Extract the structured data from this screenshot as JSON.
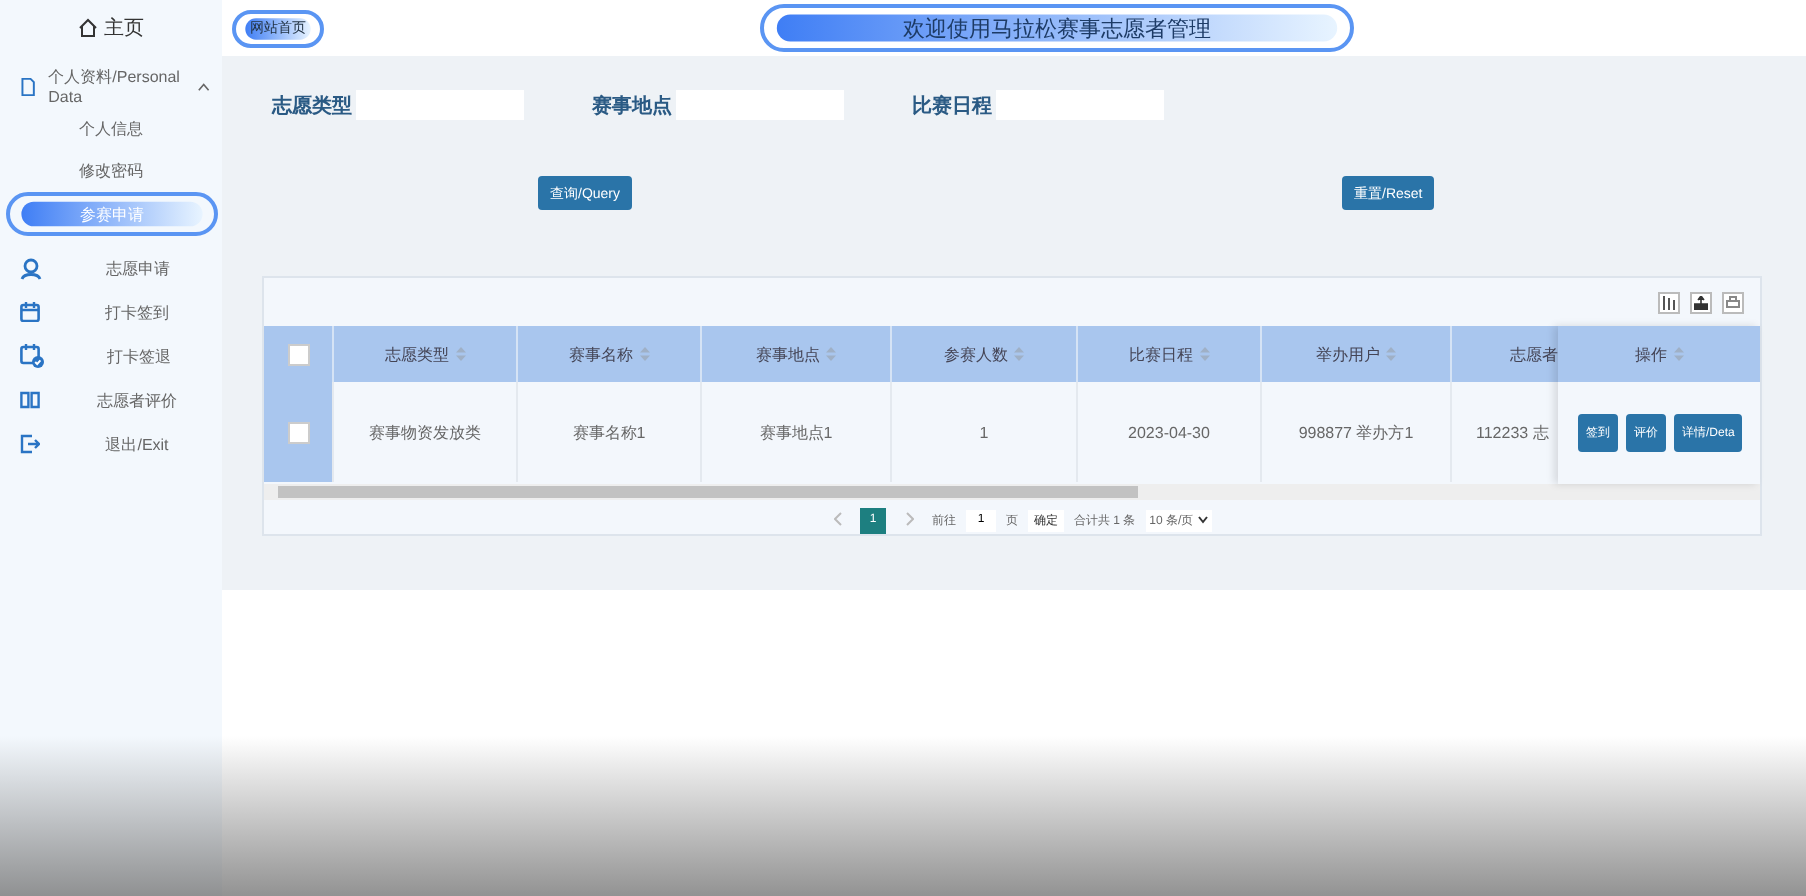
{
  "sidebar": {
    "home": "主页",
    "items": [
      {
        "label": "个人资料/Personal Data",
        "selected": false,
        "expanded": true,
        "children": [
          {
            "label": "个人信息",
            "selected": false
          },
          {
            "label": "修改密码",
            "selected": false
          },
          {
            "label": "参赛申请",
            "selected": true
          }
        ]
      },
      {
        "label": "志愿申请",
        "selected": false
      },
      {
        "label": "打卡签到",
        "selected": false
      },
      {
        "label": "打卡签退",
        "selected": false
      },
      {
        "label": "志愿者评价",
        "selected": false
      },
      {
        "label": "退出/Exit",
        "selected": false
      }
    ]
  },
  "header": {
    "breadcrumb": "网站首页",
    "title": "欢迎使用马拉松赛事志愿者管理"
  },
  "search": {
    "fields": [
      {
        "label": "志愿类型"
      },
      {
        "label": "赛事地点"
      },
      {
        "label": "比赛日程"
      }
    ],
    "buttons": [
      "查询/Query",
      "重置/Reset"
    ]
  },
  "table": {
    "header_checked": false,
    "columns": [
      "志愿类型",
      "赛事名称",
      "赛事地点",
      "参赛人数",
      "比赛日程",
      "举办用户",
      "志愿者"
    ],
    "action_column": "操作",
    "rows": [
      {
        "checked": false,
        "cells": [
          "赛事物资发放类",
          "赛事名称1",
          "赛事地点1",
          "1",
          "2023-04-30",
          "998877 举办方1",
          "112233 志"
        ],
        "actions": [
          "签到",
          "评价",
          "详情/Deta"
        ]
      }
    ]
  },
  "pagination": {
    "pages": [
      {
        "label": "1",
        "selected": true
      }
    ],
    "goto_label": "前往",
    "goto_value": "1",
    "page_unit": "页",
    "confirm": "确定",
    "total": "合计共 1 条",
    "page_size": "10 条/页"
  }
}
